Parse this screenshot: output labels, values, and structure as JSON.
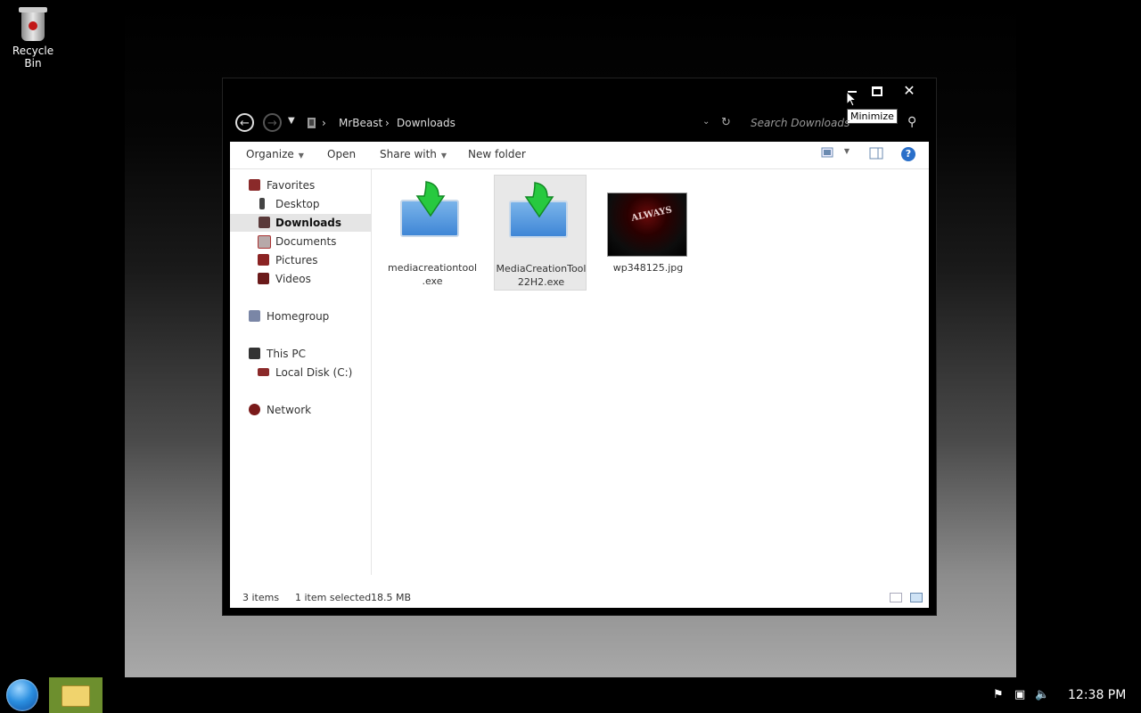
{
  "desktop": {
    "recycle_bin_label": "Recycle Bin"
  },
  "window": {
    "tooltip": "Minimize",
    "controls": {
      "minimize": "minimize",
      "maximize": "maximize",
      "close": "✕"
    },
    "breadcrumb": [
      "MrBeast",
      "Downloads"
    ],
    "search_placeholder": "Search Downloads"
  },
  "toolbar": {
    "organize": "Organize",
    "open": "Open",
    "share_with": "Share with",
    "new_folder": "New folder"
  },
  "nav": {
    "favorites": "Favorites",
    "desktop": "Desktop",
    "downloads": "Downloads",
    "documents": "Documents",
    "pictures": "Pictures",
    "videos": "Videos",
    "homegroup": "Homegroup",
    "this_pc": "This PC",
    "local_disk": "Local Disk (C:)",
    "network": "Network"
  },
  "files": [
    {
      "name_line1": "mediacreationtool",
      "name_line2": ".exe"
    },
    {
      "name_line1": "MediaCreationTool",
      "name_line2": "22H2.exe"
    },
    {
      "name_line1": "wp348125.jpg",
      "name_line2": ""
    }
  ],
  "thumbnail_text": "ALWAYS",
  "status": {
    "items_count": "3 items",
    "selection": "1 item selected",
    "size": "18.5 MB"
  },
  "taskbar": {
    "clock": "12:38 PM"
  },
  "colors": {
    "accent_green": "#6d8f2e",
    "selection_gray": "#e5e5e5",
    "help_blue": "#2a6fc9"
  }
}
